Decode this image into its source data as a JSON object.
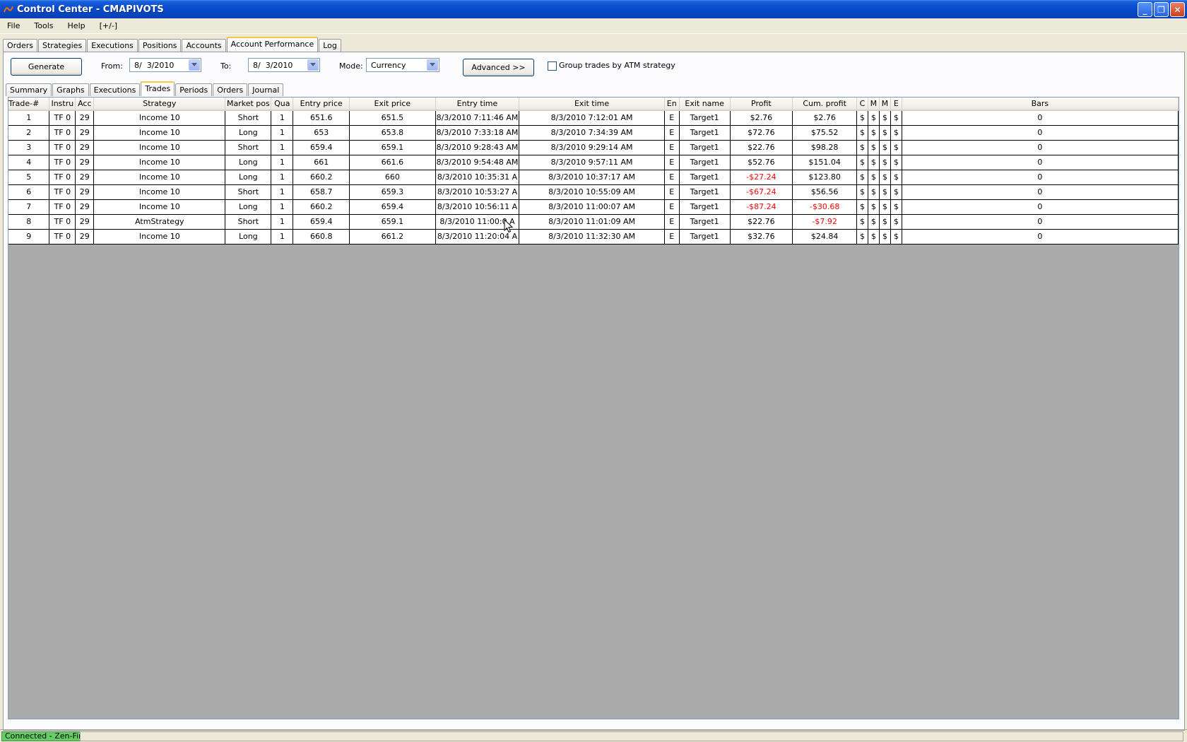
{
  "window": {
    "title": "Control Center - CMAPIVOTS"
  },
  "menu": [
    "File",
    "Tools",
    "Help",
    "[+/-]"
  ],
  "main_tabs": [
    "Orders",
    "Strategies",
    "Executions",
    "Positions",
    "Accounts",
    "Account Performance",
    "Log"
  ],
  "main_tab_active": "Account Performance",
  "toolbar": {
    "generate": "Generate",
    "from_label": "From:",
    "from_value": "8/  3/2010",
    "to_label": "To:",
    "to_value": "8/  3/2010",
    "mode_label": "Mode:",
    "mode_value": "Currency",
    "advanced": "Advanced >>",
    "group_label": "Group trades by ATM strategy"
  },
  "sub_tabs": [
    "Summary",
    "Graphs",
    "Executions",
    "Trades",
    "Periods",
    "Orders",
    "Journal"
  ],
  "sub_tab_active": "Trades",
  "grid": {
    "columns": [
      "Trade-#",
      "Instru",
      "Acc",
      "Strategy",
      "Market pos",
      "Qua",
      "Entry price",
      "Exit price",
      "Entry time",
      "Exit time",
      "En",
      "Exit name",
      "Profit",
      "Cum. profit",
      "C",
      "M",
      "M",
      "E",
      "Bars"
    ],
    "rows": [
      [
        "1",
        "TF 0",
        "29",
        "Income 10",
        "Short",
        "1",
        "651.6",
        "651.5",
        "8/3/2010 7:11:46 AM",
        "8/3/2010 7:12:01 AM",
        "E",
        "Target1",
        "$2.76",
        "$2.76",
        "$",
        "$",
        "$",
        "$",
        "0"
      ],
      [
        "2",
        "TF 0",
        "29",
        "Income 10",
        "Long",
        "1",
        "653",
        "653.8",
        "8/3/2010 7:33:18 AM",
        "8/3/2010 7:34:39 AM",
        "E",
        "Target1",
        "$72.76",
        "$75.52",
        "$",
        "$",
        "$",
        "$",
        "0"
      ],
      [
        "3",
        "TF 0",
        "29",
        "Income 10",
        "Short",
        "1",
        "659.4",
        "659.1",
        "8/3/2010 9:28:43 AM",
        "8/3/2010 9:29:14 AM",
        "E",
        "Target1",
        "$22.76",
        "$98.28",
        "$",
        "$",
        "$",
        "$",
        "0"
      ],
      [
        "4",
        "TF 0",
        "29",
        "Income 10",
        "Long",
        "1",
        "661",
        "661.6",
        "8/3/2010 9:54:48 AM",
        "8/3/2010 9:57:11 AM",
        "E",
        "Target1",
        "$52.76",
        "$151.04",
        "$",
        "$",
        "$",
        "$",
        "0"
      ],
      [
        "5",
        "TF 0",
        "29",
        "Income 10",
        "Long",
        "1",
        "660.2",
        "660",
        "8/3/2010 10:35:31 A",
        "8/3/2010 10:37:17 AM",
        "E",
        "Target1",
        "-$27.24",
        "$123.80",
        "$",
        "$",
        "$",
        "$",
        "0"
      ],
      [
        "6",
        "TF 0",
        "29",
        "Income 10",
        "Short",
        "1",
        "658.7",
        "659.3",
        "8/3/2010 10:53:27 A",
        "8/3/2010 10:55:09 AM",
        "E",
        "Target1",
        "-$67.24",
        "$56.56",
        "$",
        "$",
        "$",
        "$",
        "0"
      ],
      [
        "7",
        "TF 0",
        "29",
        "Income 10",
        "Long",
        "1",
        "660.2",
        "659.4",
        "8/3/2010 10:56:11 A",
        "8/3/2010 11:00:07 AM",
        "E",
        "Target1",
        "-$87.24",
        "-$30.68",
        "$",
        "$",
        "$",
        "$",
        "0"
      ],
      [
        "8",
        "TF 0",
        "29",
        "AtmStrategy",
        "Short",
        "1",
        "659.4",
        "659.1",
        "8/3/2010 11:00:0 A",
        "8/3/2010 11:01:09 AM",
        "E",
        "Target1",
        "$22.76",
        "-$7.92",
        "$",
        "$",
        "$",
        "$",
        "0"
      ],
      [
        "9",
        "TF 0",
        "29",
        "Income 10",
        "Long",
        "1",
        "660.8",
        "661.2",
        "8/3/2010 11:20:04 A",
        "8/3/2010 11:32:30 AM",
        "E",
        "Target1",
        "$32.76",
        "$24.84",
        "$",
        "$",
        "$",
        "$",
        "0"
      ]
    ]
  },
  "status": {
    "connection": "Connected - Zen-Fire"
  },
  "colors": {
    "negative": "#ff0000",
    "grid_bg": "#ababab",
    "connected": "#66cc66"
  }
}
